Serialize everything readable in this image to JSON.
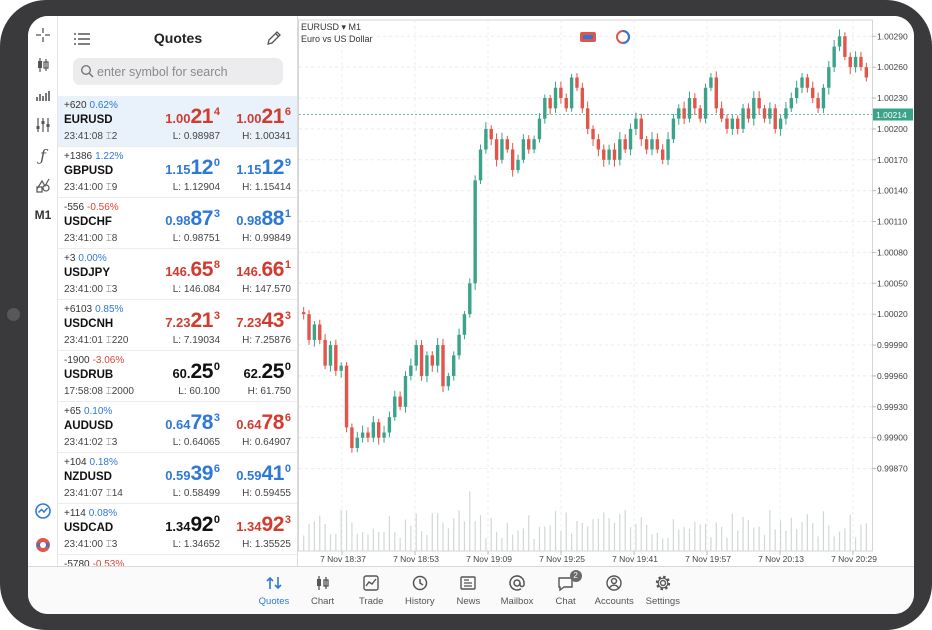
{
  "colors": {
    "accent": "#2e78d8",
    "bull": "#3aa38a",
    "bear": "#e0564a",
    "frame": "#3a3a3c"
  },
  "rail": {
    "items": [
      "crosshair-icon",
      "candlestick-icon",
      "indicators-icon",
      "sliders-icon",
      "function-icon",
      "objects-icon"
    ],
    "timeframe": "M1",
    "bottom_items": [
      "market-watch-icon",
      "one-click-trading-icon"
    ]
  },
  "quotes": {
    "title": "Quotes",
    "search": {
      "placeholder": "enter symbol for search",
      "value": ""
    },
    "rows": [
      {
        "change": "+620",
        "pct": "0.62%",
        "dir": "up",
        "symbol": "EURUSD",
        "time": "23:41:08",
        "spread": "2",
        "bid": [
          "1.00",
          "21",
          "4"
        ],
        "ask": [
          "1.00",
          "21",
          "6"
        ],
        "bid_color": "dn",
        "ask_color": "dn",
        "low": "L: 0.98987",
        "high": "H: 1.00341"
      },
      {
        "change": "+1386",
        "pct": "1.22%",
        "dir": "up",
        "symbol": "GBPUSD",
        "time": "23:41:00",
        "spread": "9",
        "bid": [
          "1.15",
          "12",
          "0"
        ],
        "ask": [
          "1.15",
          "12",
          "9"
        ],
        "bid_color": "up",
        "ask_color": "up",
        "low": "L: 1.12904",
        "high": "H: 1.15414"
      },
      {
        "change": "-556",
        "pct": "-0.56%",
        "dir": "dn",
        "symbol": "USDCHF",
        "time": "23:41:00",
        "spread": "8",
        "bid": [
          "0.98",
          "87",
          "3"
        ],
        "ask": [
          "0.98",
          "88",
          "1"
        ],
        "bid_color": "up",
        "ask_color": "up",
        "low": "L: 0.98751",
        "high": "H: 0.99849"
      },
      {
        "change": "+3",
        "pct": "0.00%",
        "dir": "up",
        "symbol": "USDJPY",
        "time": "23:41:00",
        "spread": "3",
        "bid": [
          "146.",
          "65",
          "8"
        ],
        "ask": [
          "146.",
          "66",
          "1"
        ],
        "bid_color": "dn",
        "ask_color": "dn",
        "low": "L: 146.084",
        "high": "H: 147.570"
      },
      {
        "change": "+6103",
        "pct": "0.85%",
        "dir": "up",
        "symbol": "USDCNH",
        "time": "23:41:01",
        "spread": "220",
        "bid": [
          "7.23",
          "21",
          "3"
        ],
        "ask": [
          "7.23",
          "43",
          "3"
        ],
        "bid_color": "dn",
        "ask_color": "dn",
        "low": "L: 7.19034",
        "high": "H: 7.25876"
      },
      {
        "change": "-1900",
        "pct": "-3.06%",
        "dir": "dn",
        "symbol": "USDRUB",
        "time": "17:58:08",
        "spread": "2000",
        "bid": [
          "60.",
          "25",
          "0"
        ],
        "ask": [
          "62.",
          "25",
          "0"
        ],
        "bid_color": "nt",
        "ask_color": "nt",
        "low": "L: 60.100",
        "high": "H: 61.750"
      },
      {
        "change": "+65",
        "pct": "0.10%",
        "dir": "up",
        "symbol": "AUDUSD",
        "time": "23:41:02",
        "spread": "3",
        "bid": [
          "0.64",
          "78",
          "3"
        ],
        "ask": [
          "0.64",
          "78",
          "6"
        ],
        "bid_color": "up",
        "ask_color": "dn",
        "low": "L: 0.64065",
        "high": "H: 0.64907"
      },
      {
        "change": "+104",
        "pct": "0.18%",
        "dir": "up",
        "symbol": "NZDUSD",
        "time": "23:41:07",
        "spread": "14",
        "bid": [
          "0.59",
          "39",
          "6"
        ],
        "ask": [
          "0.59",
          "41",
          "0"
        ],
        "bid_color": "up",
        "ask_color": "up",
        "low": "L: 0.58499",
        "high": "H: 0.59455"
      },
      {
        "change": "+114",
        "pct": "0.08%",
        "dir": "up",
        "symbol": "USDCAD",
        "time": "23:41:00",
        "spread": "3",
        "bid": [
          "1.34",
          "92",
          "0"
        ],
        "ask": [
          "1.34",
          "92",
          "3"
        ],
        "bid_color": "nt",
        "ask_color": "dn",
        "low": "L: 1.34652",
        "high": "H: 1.35525"
      },
      {
        "change": "-5780",
        "pct": "-0.53%",
        "dir": "dn",
        "symbol": "",
        "time": "",
        "spread": "",
        "bid": [
          "",
          "",
          ""
        ],
        "ask": [
          "",
          "",
          ""
        ],
        "bid_color": "nt",
        "ask_color": "nt",
        "low": "",
        "high": ""
      }
    ]
  },
  "chart": {
    "symbol": "EURUSD ▾ M1",
    "description": "Euro vs US Dollar",
    "current_price": "1.00214"
  },
  "chart_data": {
    "type": "candlestick",
    "y_ticks": [
      "1.00290",
      "1.00260",
      "1.00230",
      "1.00200",
      "1.00170",
      "1.00140",
      "1.00110",
      "1.00080",
      "1.00050",
      "1.00020",
      "0.99990",
      "0.99960",
      "0.99930",
      "0.99900",
      "0.99870"
    ],
    "y_tick_values": [
      1.0029,
      1.0026,
      1.0023,
      1.002,
      1.0017,
      1.0014,
      1.0011,
      1.0008,
      1.0005,
      1.0002,
      0.9999,
      0.9996,
      0.9993,
      0.999,
      0.9987
    ],
    "ylim": [
      0.99855,
      1.003
    ],
    "x_ticks": [
      "7 Nov 18:37",
      "7 Nov 18:53",
      "7 Nov 19:09",
      "7 Nov 19:25",
      "7 Nov 19:41",
      "7 Nov 19:57",
      "7 Nov 20:13",
      "7 Nov 20:29"
    ],
    "current_line": 1.00214,
    "grid": true,
    "closes": [
      1.0002,
      0.99995,
      1.0001,
      0.99995,
      0.9997,
      0.9999,
      0.99965,
      0.9997,
      0.9991,
      0.9989,
      0.999,
      0.99905,
      0.999,
      0.99915,
      0.999,
      0.99905,
      0.9992,
      0.9994,
      0.9993,
      0.9996,
      0.9997,
      0.9999,
      0.9996,
      0.9998,
      0.9997,
      0.9999,
      0.9995,
      0.9996,
      0.9998,
      1.0,
      1.0002,
      1.0005,
      1.0015,
      1.0018,
      1.002,
      1.0019,
      1.0017,
      1.0019,
      1.0018,
      1.0016,
      1.0017,
      1.0019,
      1.0018,
      1.0019,
      1.0021,
      1.0023,
      1.0022,
      1.0024,
      1.0023,
      1.0022,
      1.0025,
      1.0024,
      1.0022,
      1.002,
      1.0019,
      1.0018,
      1.0017,
      1.0018,
      1.0017,
      1.0019,
      1.0018,
      1.002,
      1.0021,
      1.0019,
      1.0018,
      1.0019,
      1.0018,
      1.0017,
      1.0019,
      1.0021,
      1.0022,
      1.0021,
      1.0023,
      1.0022,
      1.0021,
      1.0024,
      1.0025,
      1.0022,
      1.0021,
      1.002,
      1.0021,
      1.002,
      1.0022,
      1.0021,
      1.0023,
      1.0022,
      1.0021,
      1.0022,
      1.002,
      1.0021,
      1.0022,
      1.0023,
      1.0024,
      1.0025,
      1.0024,
      1.0023,
      1.0022,
      1.0024,
      1.0026,
      1.0028,
      1.0029,
      1.0027,
      1.0026,
      1.0027,
      1.0026,
      1.0025
    ]
  },
  "tabs": [
    {
      "label": "Quotes",
      "icon": "quotes-icon",
      "active": true
    },
    {
      "label": "Chart",
      "icon": "chart-icon",
      "active": false
    },
    {
      "label": "Trade",
      "icon": "trade-icon",
      "active": false
    },
    {
      "label": "History",
      "icon": "history-icon",
      "active": false
    },
    {
      "label": "News",
      "icon": "news-icon",
      "active": false
    },
    {
      "label": "Mailbox",
      "icon": "mailbox-icon",
      "active": false
    },
    {
      "label": "Chat",
      "icon": "chat-icon",
      "active": false,
      "badge": "2"
    },
    {
      "label": "Accounts",
      "icon": "accounts-icon",
      "active": false
    },
    {
      "label": "Settings",
      "icon": "settings-icon",
      "active": false
    }
  ]
}
